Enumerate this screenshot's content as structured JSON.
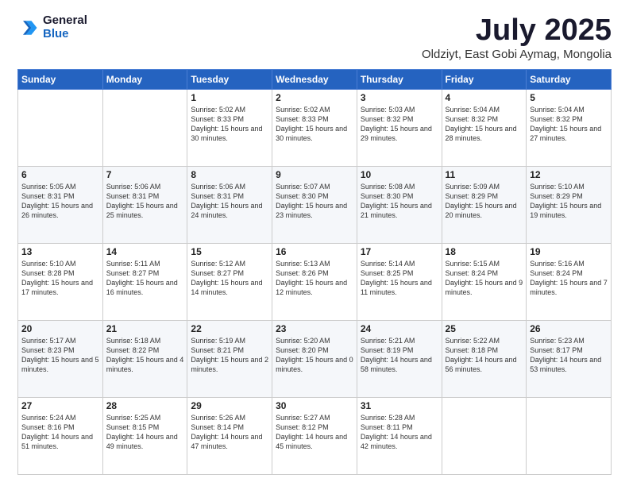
{
  "logo": {
    "general": "General",
    "blue": "Blue"
  },
  "title": "July 2025",
  "subtitle": "Oldziyt, East Gobi Aymag, Mongolia",
  "days": [
    "Sunday",
    "Monday",
    "Tuesday",
    "Wednesday",
    "Thursday",
    "Friday",
    "Saturday"
  ],
  "weeks": [
    [
      {
        "day": "",
        "sunrise": "",
        "sunset": "",
        "daylight": ""
      },
      {
        "day": "",
        "sunrise": "",
        "sunset": "",
        "daylight": ""
      },
      {
        "day": "1",
        "sunrise": "Sunrise: 5:02 AM",
        "sunset": "Sunset: 8:33 PM",
        "daylight": "Daylight: 15 hours and 30 minutes."
      },
      {
        "day": "2",
        "sunrise": "Sunrise: 5:02 AM",
        "sunset": "Sunset: 8:33 PM",
        "daylight": "Daylight: 15 hours and 30 minutes."
      },
      {
        "day": "3",
        "sunrise": "Sunrise: 5:03 AM",
        "sunset": "Sunset: 8:32 PM",
        "daylight": "Daylight: 15 hours and 29 minutes."
      },
      {
        "day": "4",
        "sunrise": "Sunrise: 5:04 AM",
        "sunset": "Sunset: 8:32 PM",
        "daylight": "Daylight: 15 hours and 28 minutes."
      },
      {
        "day": "5",
        "sunrise": "Sunrise: 5:04 AM",
        "sunset": "Sunset: 8:32 PM",
        "daylight": "Daylight: 15 hours and 27 minutes."
      }
    ],
    [
      {
        "day": "6",
        "sunrise": "Sunrise: 5:05 AM",
        "sunset": "Sunset: 8:31 PM",
        "daylight": "Daylight: 15 hours and 26 minutes."
      },
      {
        "day": "7",
        "sunrise": "Sunrise: 5:06 AM",
        "sunset": "Sunset: 8:31 PM",
        "daylight": "Daylight: 15 hours and 25 minutes."
      },
      {
        "day": "8",
        "sunrise": "Sunrise: 5:06 AM",
        "sunset": "Sunset: 8:31 PM",
        "daylight": "Daylight: 15 hours and 24 minutes."
      },
      {
        "day": "9",
        "sunrise": "Sunrise: 5:07 AM",
        "sunset": "Sunset: 8:30 PM",
        "daylight": "Daylight: 15 hours and 23 minutes."
      },
      {
        "day": "10",
        "sunrise": "Sunrise: 5:08 AM",
        "sunset": "Sunset: 8:30 PM",
        "daylight": "Daylight: 15 hours and 21 minutes."
      },
      {
        "day": "11",
        "sunrise": "Sunrise: 5:09 AM",
        "sunset": "Sunset: 8:29 PM",
        "daylight": "Daylight: 15 hours and 20 minutes."
      },
      {
        "day": "12",
        "sunrise": "Sunrise: 5:10 AM",
        "sunset": "Sunset: 8:29 PM",
        "daylight": "Daylight: 15 hours and 19 minutes."
      }
    ],
    [
      {
        "day": "13",
        "sunrise": "Sunrise: 5:10 AM",
        "sunset": "Sunset: 8:28 PM",
        "daylight": "Daylight: 15 hours and 17 minutes."
      },
      {
        "day": "14",
        "sunrise": "Sunrise: 5:11 AM",
        "sunset": "Sunset: 8:27 PM",
        "daylight": "Daylight: 15 hours and 16 minutes."
      },
      {
        "day": "15",
        "sunrise": "Sunrise: 5:12 AM",
        "sunset": "Sunset: 8:27 PM",
        "daylight": "Daylight: 15 hours and 14 minutes."
      },
      {
        "day": "16",
        "sunrise": "Sunrise: 5:13 AM",
        "sunset": "Sunset: 8:26 PM",
        "daylight": "Daylight: 15 hours and 12 minutes."
      },
      {
        "day": "17",
        "sunrise": "Sunrise: 5:14 AM",
        "sunset": "Sunset: 8:25 PM",
        "daylight": "Daylight: 15 hours and 11 minutes."
      },
      {
        "day": "18",
        "sunrise": "Sunrise: 5:15 AM",
        "sunset": "Sunset: 8:24 PM",
        "daylight": "Daylight: 15 hours and 9 minutes."
      },
      {
        "day": "19",
        "sunrise": "Sunrise: 5:16 AM",
        "sunset": "Sunset: 8:24 PM",
        "daylight": "Daylight: 15 hours and 7 minutes."
      }
    ],
    [
      {
        "day": "20",
        "sunrise": "Sunrise: 5:17 AM",
        "sunset": "Sunset: 8:23 PM",
        "daylight": "Daylight: 15 hours and 5 minutes."
      },
      {
        "day": "21",
        "sunrise": "Sunrise: 5:18 AM",
        "sunset": "Sunset: 8:22 PM",
        "daylight": "Daylight: 15 hours and 4 minutes."
      },
      {
        "day": "22",
        "sunrise": "Sunrise: 5:19 AM",
        "sunset": "Sunset: 8:21 PM",
        "daylight": "Daylight: 15 hours and 2 minutes."
      },
      {
        "day": "23",
        "sunrise": "Sunrise: 5:20 AM",
        "sunset": "Sunset: 8:20 PM",
        "daylight": "Daylight: 15 hours and 0 minutes."
      },
      {
        "day": "24",
        "sunrise": "Sunrise: 5:21 AM",
        "sunset": "Sunset: 8:19 PM",
        "daylight": "Daylight: 14 hours and 58 minutes."
      },
      {
        "day": "25",
        "sunrise": "Sunrise: 5:22 AM",
        "sunset": "Sunset: 8:18 PM",
        "daylight": "Daylight: 14 hours and 56 minutes."
      },
      {
        "day": "26",
        "sunrise": "Sunrise: 5:23 AM",
        "sunset": "Sunset: 8:17 PM",
        "daylight": "Daylight: 14 hours and 53 minutes."
      }
    ],
    [
      {
        "day": "27",
        "sunrise": "Sunrise: 5:24 AM",
        "sunset": "Sunset: 8:16 PM",
        "daylight": "Daylight: 14 hours and 51 minutes."
      },
      {
        "day": "28",
        "sunrise": "Sunrise: 5:25 AM",
        "sunset": "Sunset: 8:15 PM",
        "daylight": "Daylight: 14 hours and 49 minutes."
      },
      {
        "day": "29",
        "sunrise": "Sunrise: 5:26 AM",
        "sunset": "Sunset: 8:14 PM",
        "daylight": "Daylight: 14 hours and 47 minutes."
      },
      {
        "day": "30",
        "sunrise": "Sunrise: 5:27 AM",
        "sunset": "Sunset: 8:12 PM",
        "daylight": "Daylight: 14 hours and 45 minutes."
      },
      {
        "day": "31",
        "sunrise": "Sunrise: 5:28 AM",
        "sunset": "Sunset: 8:11 PM",
        "daylight": "Daylight: 14 hours and 42 minutes."
      },
      {
        "day": "",
        "sunrise": "",
        "sunset": "",
        "daylight": ""
      },
      {
        "day": "",
        "sunrise": "",
        "sunset": "",
        "daylight": ""
      }
    ]
  ]
}
